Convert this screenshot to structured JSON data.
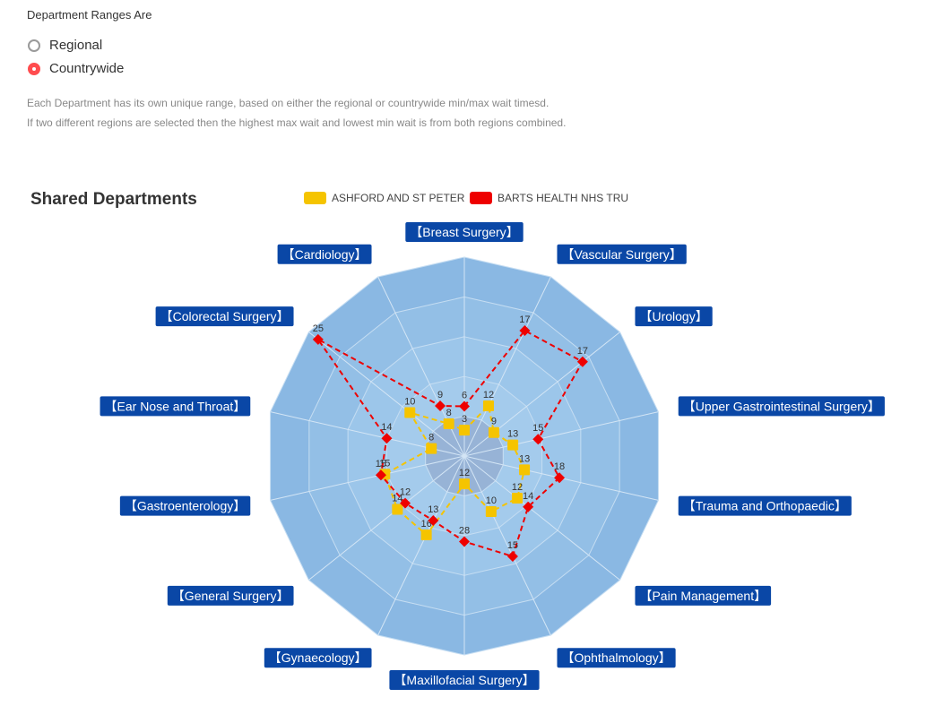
{
  "settings": {
    "section_label": "Department Ranges Are",
    "options": [
      {
        "label": "Regional",
        "selected": false
      },
      {
        "label": "Countrywide",
        "selected": true
      }
    ],
    "note_line1": "Each Department has its own unique range, based on either the regional or countrywide min/max wait timesd.",
    "note_line2": "If two different regions are selected then the highest max wait and lowest min wait is from both regions combined."
  },
  "colors": {
    "series1": "#f5c400",
    "series2": "#ee0000",
    "label_bg": "#0a47a6",
    "ring_outer": "#89b7e2",
    "ring_inner": "#a9cfee",
    "accent_radio": "#ff4d4f"
  },
  "chart_data": {
    "type": "radar",
    "title": "Shared Departments",
    "legend_position": "top",
    "categories": [
      "【Breast Surgery】",
      "【Vascular Surgery】",
      "【Urology】",
      "【Upper Gastrointestinal Surgery】",
      "【Trauma and Orthopaedic】",
      "【Pain Management】",
      "【Ophthalmology】",
      "【Maxillofacial Surgery】",
      "【Gynaecology】",
      "【General Surgery】",
      "【Gastroenterology】",
      "【Ear Nose and Throat】",
      "【Colorectal Surgery】",
      "【Cardiology】"
    ],
    "series": [
      {
        "name": "ASHFORD AND ST PETER",
        "marker": "square",
        "values": [
          3,
          12,
          9,
          13,
          13,
          12,
          10,
          12,
          16,
          14,
          15,
          8,
          10,
          8
        ],
        "fractions": [
          0.13,
          0.28,
          0.19,
          0.25,
          0.31,
          0.34,
          0.31,
          0.14,
          0.44,
          0.43,
          0.41,
          0.17,
          0.35,
          0.18
        ]
      },
      {
        "name": "BARTS HEALTH NHS TRU",
        "marker": "diamond",
        "values": [
          6,
          17,
          17,
          15,
          18,
          14,
          15,
          28,
          13,
          12,
          15,
          14,
          25,
          9
        ],
        "fractions": [
          0.25,
          0.7,
          0.76,
          0.38,
          0.49,
          0.41,
          0.56,
          0.43,
          0.36,
          0.38,
          0.43,
          0.4,
          0.94,
          0.28
        ]
      }
    ]
  }
}
